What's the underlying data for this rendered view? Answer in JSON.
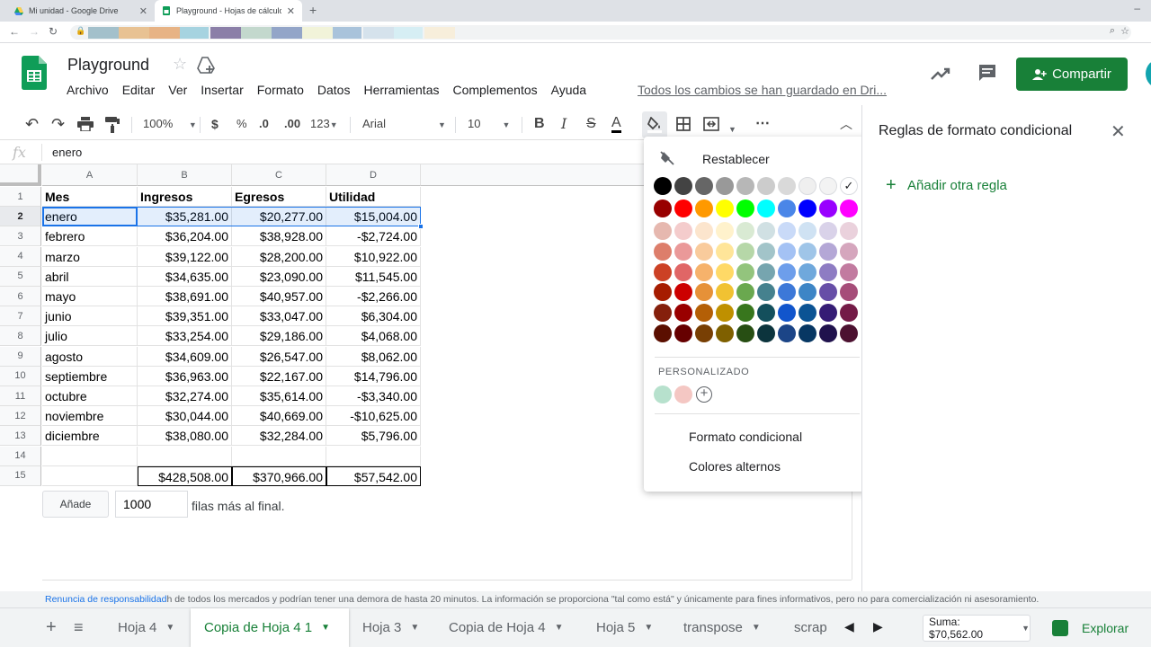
{
  "browser": {
    "tabs": [
      {
        "title": "Mi unidad - Google Drive"
      },
      {
        "title": "Playground - Hojas de cálculo de"
      }
    ],
    "bookmark_colors": [
      "#a3c0cb",
      "#e8c293",
      "#e7b385",
      "#a6d3e0",
      "#8b7fa8",
      "#c3d8cd",
      "#93a5c8",
      "#f1f3d9",
      "#a9c3db",
      "#d5e2ec",
      "#d6eef4",
      "#f7eedb"
    ]
  },
  "header": {
    "title": "Playground",
    "menu": [
      "Archivo",
      "Editar",
      "Ver",
      "Insertar",
      "Formato",
      "Datos",
      "Herramientas",
      "Complementos",
      "Ayuda"
    ],
    "save_status": "Todos los cambios se han guardado en Dri...",
    "share_label": "Compartir",
    "brand_color": "#188038"
  },
  "toolbar": {
    "zoom": "100%",
    "currency": "$",
    "percent": "%",
    "dec_less": ".0",
    "dec_more": ".00",
    "format_more": "123",
    "font": "Arial",
    "font_size": "10",
    "bold": "B",
    "italic": "I",
    "strike": "S",
    "text_color": "A",
    "more": "⋯"
  },
  "formula": {
    "fx": "fx",
    "value": "enero"
  },
  "grid": {
    "columns": [
      "A",
      "B",
      "C",
      "D"
    ],
    "rows": [
      {
        "n": "1",
        "cells": [
          "Mes",
          "Ingresos",
          "Egresos",
          "Utilidad"
        ]
      },
      {
        "n": "2",
        "cells": [
          "enero",
          "$35,281.00",
          "$20,277.00",
          "$15,004.00"
        ]
      },
      {
        "n": "3",
        "cells": [
          "febrero",
          "$36,204.00",
          "$38,928.00",
          "-$2,724.00"
        ]
      },
      {
        "n": "4",
        "cells": [
          "marzo",
          "$39,122.00",
          "$28,200.00",
          "$10,922.00"
        ]
      },
      {
        "n": "5",
        "cells": [
          "abril",
          "$34,635.00",
          "$23,090.00",
          "$11,545.00"
        ]
      },
      {
        "n": "6",
        "cells": [
          "mayo",
          "$38,691.00",
          "$40,957.00",
          "-$2,266.00"
        ]
      },
      {
        "n": "7",
        "cells": [
          "junio",
          "$39,351.00",
          "$33,047.00",
          "$6,304.00"
        ]
      },
      {
        "n": "8",
        "cells": [
          "julio",
          "$33,254.00",
          "$29,186.00",
          "$4,068.00"
        ]
      },
      {
        "n": "9",
        "cells": [
          "agosto",
          "$34,609.00",
          "$26,547.00",
          "$8,062.00"
        ]
      },
      {
        "n": "10",
        "cells": [
          "septiembre",
          "$36,963.00",
          "$22,167.00",
          "$14,796.00"
        ]
      },
      {
        "n": "11",
        "cells": [
          "octubre",
          "$32,274.00",
          "$35,614.00",
          "-$3,340.00"
        ]
      },
      {
        "n": "12",
        "cells": [
          "noviembre",
          "$30,044.00",
          "$40,669.00",
          "-$10,625.00"
        ]
      },
      {
        "n": "13",
        "cells": [
          "diciembre",
          "$38,080.00",
          "$32,284.00",
          "$5,796.00"
        ]
      },
      {
        "n": "14",
        "cells": [
          "",
          "",
          "",
          ""
        ]
      },
      {
        "n": "15",
        "cells": [
          "",
          "$428,508.00",
          "$370,966.00",
          "$57,542.00"
        ]
      }
    ],
    "selected_row": "2",
    "add_rows": {
      "button": "Añade",
      "value": "1000",
      "label": "filas más al final."
    }
  },
  "color_picker": {
    "reset_label": "Restablecer",
    "palette": [
      [
        "#000000",
        "#434343",
        "#666666",
        "#999999",
        "#b7b7b7",
        "#cccccc",
        "#d9d9d9",
        "#efefef",
        "#f3f3f3",
        "#ffffff"
      ],
      [
        "#980000",
        "#ff0000",
        "#ff9900",
        "#ffff00",
        "#00ff00",
        "#00ffff",
        "#4a86e8",
        "#0000ff",
        "#9900ff",
        "#ff00ff"
      ],
      [
        "#e6b8af",
        "#f4cccc",
        "#fce5cd",
        "#fff2cc",
        "#d9ead3",
        "#d0e0e3",
        "#c9daf8",
        "#cfe2f3",
        "#d9d2e9",
        "#ead1dc"
      ],
      [
        "#dd7e6b",
        "#ea9999",
        "#f9cb9c",
        "#ffe599",
        "#b6d7a8",
        "#a2c4c9",
        "#a4c2f4",
        "#9fc5e8",
        "#b4a7d6",
        "#d5a6bd"
      ],
      [
        "#cc4125",
        "#e06666",
        "#f6b26b",
        "#ffd966",
        "#93c47d",
        "#76a5af",
        "#6d9eeb",
        "#6fa8dc",
        "#8e7cc3",
        "#c27ba0"
      ],
      [
        "#a61c00",
        "#cc0000",
        "#e69138",
        "#f1c232",
        "#6aa84f",
        "#45818e",
        "#3c78d8",
        "#3d85c6",
        "#674ea7",
        "#a64d79"
      ],
      [
        "#85200c",
        "#990000",
        "#b45f06",
        "#bf9000",
        "#38761d",
        "#134f5c",
        "#1155cc",
        "#0b5394",
        "#351c75",
        "#741b47"
      ],
      [
        "#5b0f00",
        "#660000",
        "#783f04",
        "#7f6000",
        "#274e13",
        "#0c343d",
        "#1c4587",
        "#073763",
        "#20124d",
        "#4c1130"
      ]
    ],
    "custom_title": "PERSONALIZADO",
    "custom_colors": [
      "#b7e1cd",
      "#f4c7c3"
    ],
    "options": [
      "Formato condicional",
      "Colores alternos"
    ]
  },
  "side_panel": {
    "title": "Reglas de formato condicional",
    "add_rule": "Añadir otra regla"
  },
  "disclaimer": {
    "link": "Renuncia de responsabilidad",
    "text": "h de todos los mercados y podrían tener una demora de hasta 20 minutos. La información se proporciona \"tal como está\" y únicamente para fines informativos, pero no para comercialización ni asesoramiento."
  },
  "sheets": {
    "tabs": [
      "Hoja 4",
      "Copia de Hoja 4 1",
      "Hoja 3",
      "Copia de Hoja 4",
      "Hoja 5",
      "transpose",
      "scrap"
    ],
    "active": "Copia de Hoja 4 1",
    "sum": "Suma: $70,562.00",
    "explore": "Explorar"
  }
}
